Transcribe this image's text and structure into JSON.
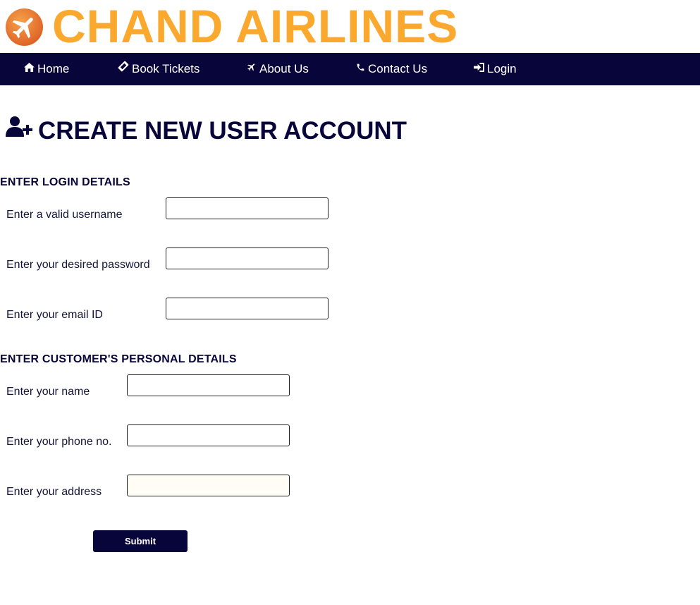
{
  "brand": {
    "name": "CHAND AIRLINES",
    "logo_icon": "airplane-icon",
    "color": "#fba92e"
  },
  "nav": {
    "background": "#08053a",
    "items": [
      {
        "label": "Home",
        "icon": "home-icon"
      },
      {
        "label": "Book Tickets",
        "icon": "ticket-icon"
      },
      {
        "label": "About Us",
        "icon": "plane-icon"
      },
      {
        "label": "Contact Us",
        "icon": "phone-icon"
      },
      {
        "label": "Login",
        "icon": "login-icon"
      }
    ]
  },
  "page": {
    "title": "CREATE NEW USER ACCOUNT",
    "title_icon": "user-plus-icon"
  },
  "login_section": {
    "heading": "ENTER LOGIN DETAILS",
    "fields": [
      {
        "label": "Enter a valid username",
        "value": ""
      },
      {
        "label": "Enter your desired password",
        "value": ""
      },
      {
        "label": "Enter your email ID",
        "value": ""
      }
    ]
  },
  "personal_section": {
    "heading": "ENTER CUSTOMER'S PERSONAL DETAILS",
    "fields": [
      {
        "label": "Enter your name",
        "value": ""
      },
      {
        "label": "Enter your phone no.",
        "value": ""
      },
      {
        "label": "Enter your address",
        "value": ""
      }
    ]
  },
  "form": {
    "submit_label": "Submit"
  }
}
